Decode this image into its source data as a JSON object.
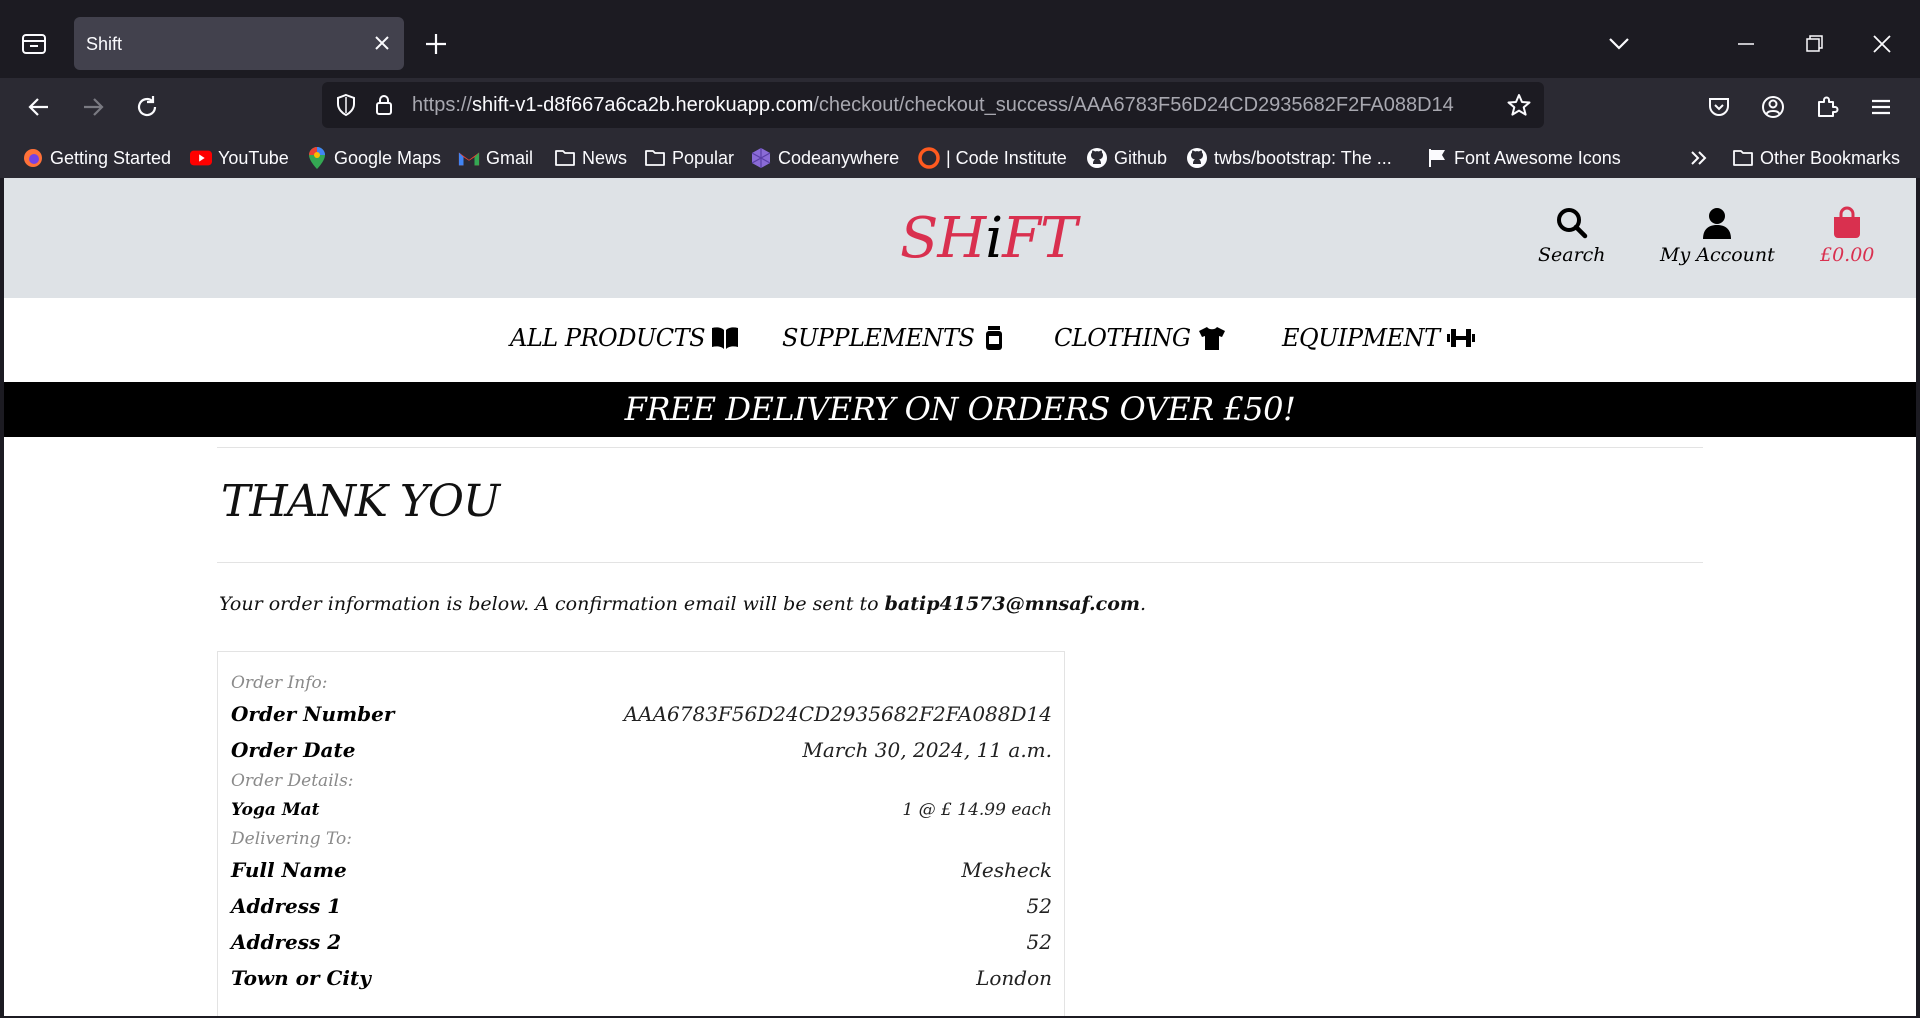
{
  "browser": {
    "tab_title": "Shift",
    "url_host_prefix": "https://",
    "url_host": "shift-v1-d8f667a6ca2b.herokuapp.com",
    "url_path": "/checkout/checkout_success/AAA6783F56D24CD2935682F2FA088D14",
    "bookmarks": [
      {
        "label": "Getting Started",
        "icon": "firefox-icon"
      },
      {
        "label": "YouTube",
        "icon": "youtube-icon"
      },
      {
        "label": "Google Maps",
        "icon": "google-maps-icon"
      },
      {
        "label": "Gmail",
        "icon": "gmail-icon"
      },
      {
        "label": "News",
        "icon": "folder-icon"
      },
      {
        "label": "Popular",
        "icon": "folder-icon"
      },
      {
        "label": "Codeanywhere",
        "icon": "codeanywhere-icon"
      },
      {
        "label": "| Code Institute",
        "icon": "code-institute-icon"
      },
      {
        "label": "Github",
        "icon": "github-icon"
      },
      {
        "label": "twbs/bootstrap: The ...",
        "icon": "github-icon"
      },
      {
        "label": "Font Awesome Icons",
        "icon": "font-awesome-icon"
      }
    ],
    "other_bookmarks": "Other Bookmarks"
  },
  "site": {
    "logo_left": "SH",
    "logo_mid": "i",
    "logo_right": "FT",
    "header": {
      "search_label": "Search",
      "account_label": "My Account",
      "cart_label": "£0.00"
    },
    "nav": [
      {
        "label": "ALL PRODUCTS",
        "icon": "book-icon"
      },
      {
        "label": "SUPPLEMENTS",
        "icon": "supplement-jar-icon"
      },
      {
        "label": "CLOTHING",
        "icon": "tshirt-icon"
      },
      {
        "label": "EQUIPMENT",
        "icon": "dumbbell-icon"
      }
    ],
    "banner": "FREE DELIVERY ON ORDERS OVER £50!"
  },
  "page": {
    "title": "THANK YOU",
    "intro_text": "Your order information is below. A confirmation email will be sent to ",
    "email": "batip41573@mnsaf.com",
    "intro_end": "."
  },
  "order": {
    "info_label": "Order Info:",
    "number_label": "Order Number",
    "number_value": "AAA6783F56D24CD2935682F2FA088D14",
    "date_label": "Order Date",
    "date_value": "March 30, 2024, 11 a.m.",
    "details_label": "Order Details:",
    "item_name": "Yoga Mat",
    "item_qty_price": "1 @ £ 14.99 each",
    "delivering_label": "Delivering To:",
    "full_name_label": "Full Name",
    "full_name_value": "Mesheck",
    "address1_label": "Address 1",
    "address1_value": "52",
    "address2_label": "Address 2",
    "address2_value": "52",
    "town_label": "Town or City",
    "town_value": "London"
  }
}
